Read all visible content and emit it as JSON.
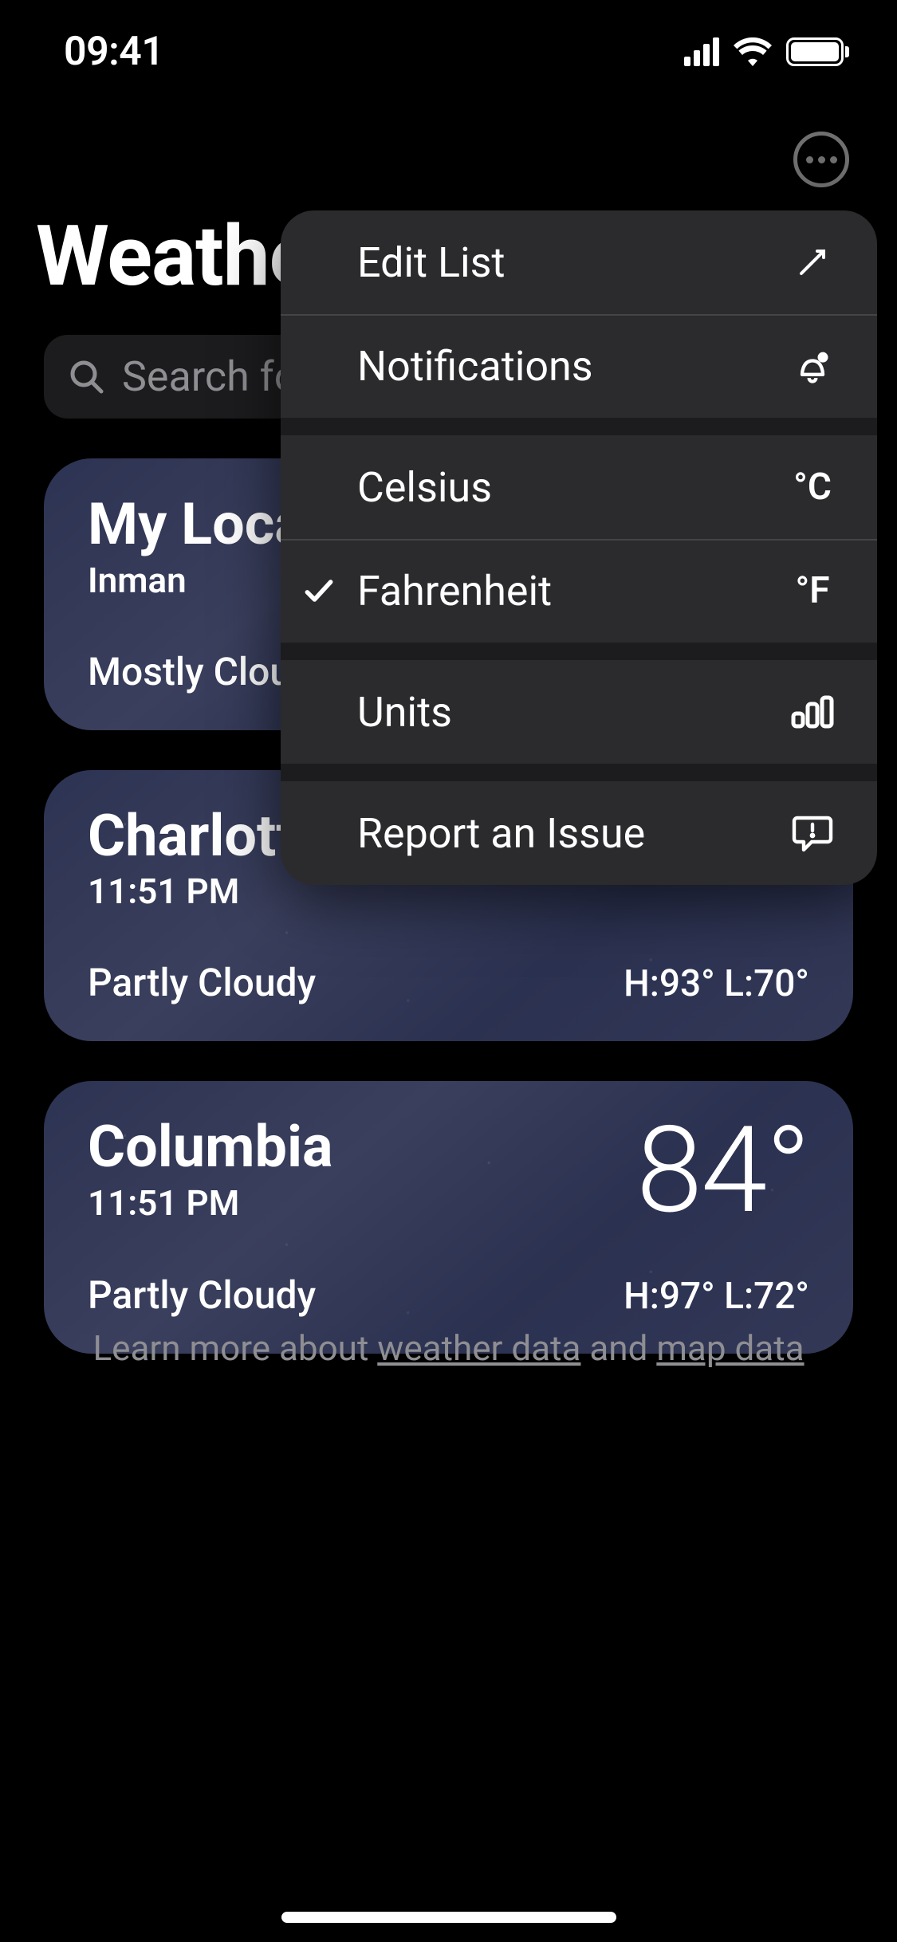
{
  "status_bar": {
    "time": "09:41"
  },
  "header": {
    "title": "Weather"
  },
  "search": {
    "placeholder": "Search for a city or airport"
  },
  "cards": [
    {
      "title": "My Location",
      "subtitle": "Inman",
      "temp": "",
      "condition": "Mostly Cloudy",
      "high_low": ""
    },
    {
      "title": "Charlotte",
      "subtitle": "11:51 PM",
      "temp": "",
      "condition": "Partly Cloudy",
      "high_low": "H:93°  L:70°"
    },
    {
      "title": "Columbia",
      "subtitle": "11:51 PM",
      "temp": "84°",
      "condition": "Partly Cloudy",
      "high_low": "H:97°  L:72°"
    }
  ],
  "footer": {
    "prefix": "Learn more about ",
    "link1": "weather data",
    "middle": " and ",
    "link2": "map data"
  },
  "menu": {
    "groups": [
      [
        {
          "label": "Edit List",
          "icon": "pencil",
          "checked": false
        },
        {
          "label": "Notifications",
          "icon": "bell",
          "checked": false
        }
      ],
      [
        {
          "label": "Celsius",
          "trailing_text": "°C",
          "checked": false
        },
        {
          "label": "Fahrenheit",
          "trailing_text": "°F",
          "checked": true
        }
      ],
      [
        {
          "label": "Units",
          "icon": "bars",
          "checked": false
        }
      ],
      [
        {
          "label": "Report an Issue",
          "icon": "report",
          "checked": false
        }
      ]
    ]
  }
}
